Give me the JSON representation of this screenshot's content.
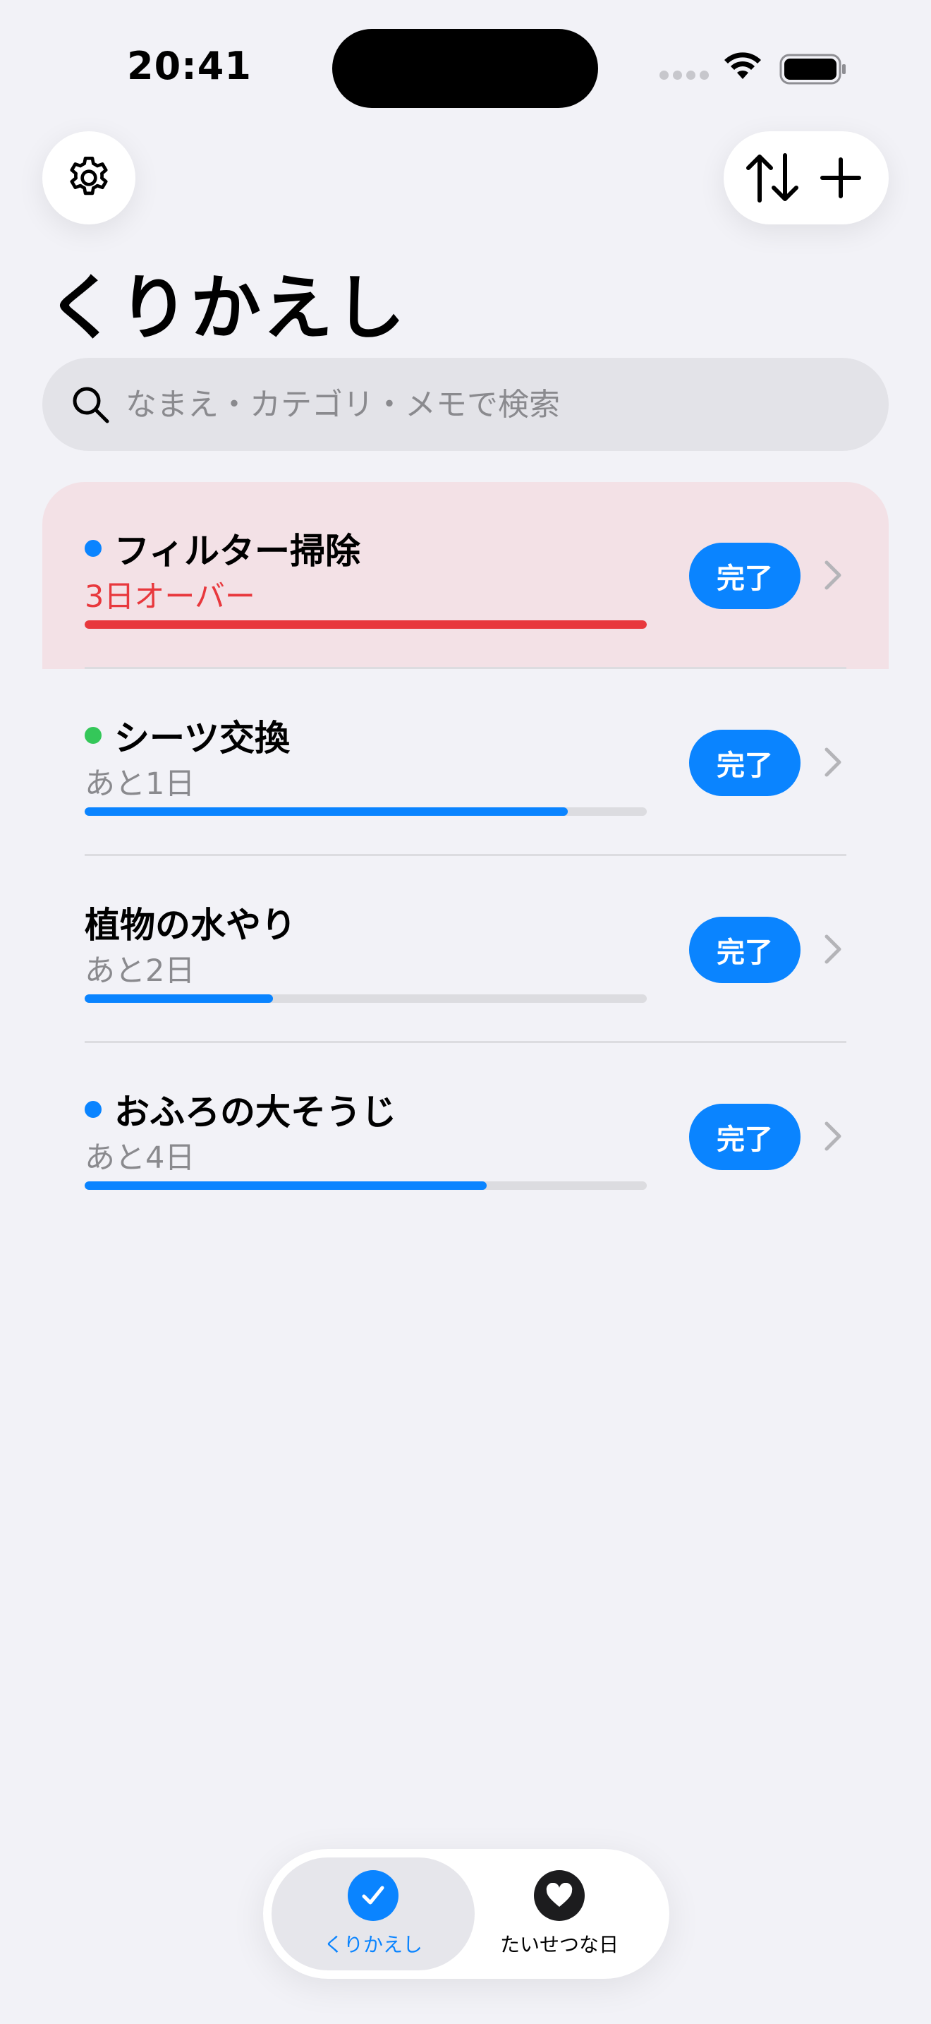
{
  "status": {
    "time": "20:41"
  },
  "header": {
    "title": "くりかえし"
  },
  "search": {
    "placeholder": "なまえ・カテゴリ・メモで検索"
  },
  "items": [
    {
      "title": "フィルター掃除",
      "status": "3日オーバー",
      "progress": 1.0,
      "dot": "#0a84ff",
      "bar_color": "#e8383d",
      "state": "overdue",
      "done_label": "完了"
    },
    {
      "title": "シーツ交換",
      "status": "あと1日",
      "progress": 0.86,
      "dot": "#34c759",
      "bar_color": "#0a84ff",
      "state": "normal",
      "done_label": "完了"
    },
    {
      "title": "植物の水やり",
      "status": "あと2日",
      "progress": 0.335,
      "dot": "",
      "bar_color": "#0a84ff",
      "state": "normal",
      "done_label": "完了"
    },
    {
      "title": "おふろの大そうじ",
      "status": "あと4日",
      "progress": 0.715,
      "dot": "#0a84ff",
      "bar_color": "#0a84ff",
      "state": "normal",
      "done_label": "完了"
    }
  ],
  "tabbar": {
    "tabs": [
      {
        "label": "くりかえし",
        "icon": "checkmark-icon",
        "active": true
      },
      {
        "label": "たいせつな日",
        "icon": "heart-icon",
        "active": false
      }
    ]
  },
  "colors": {
    "accent": "#0a84ff",
    "danger": "#e8383d",
    "overdue_bg": "#f3e1e6"
  }
}
